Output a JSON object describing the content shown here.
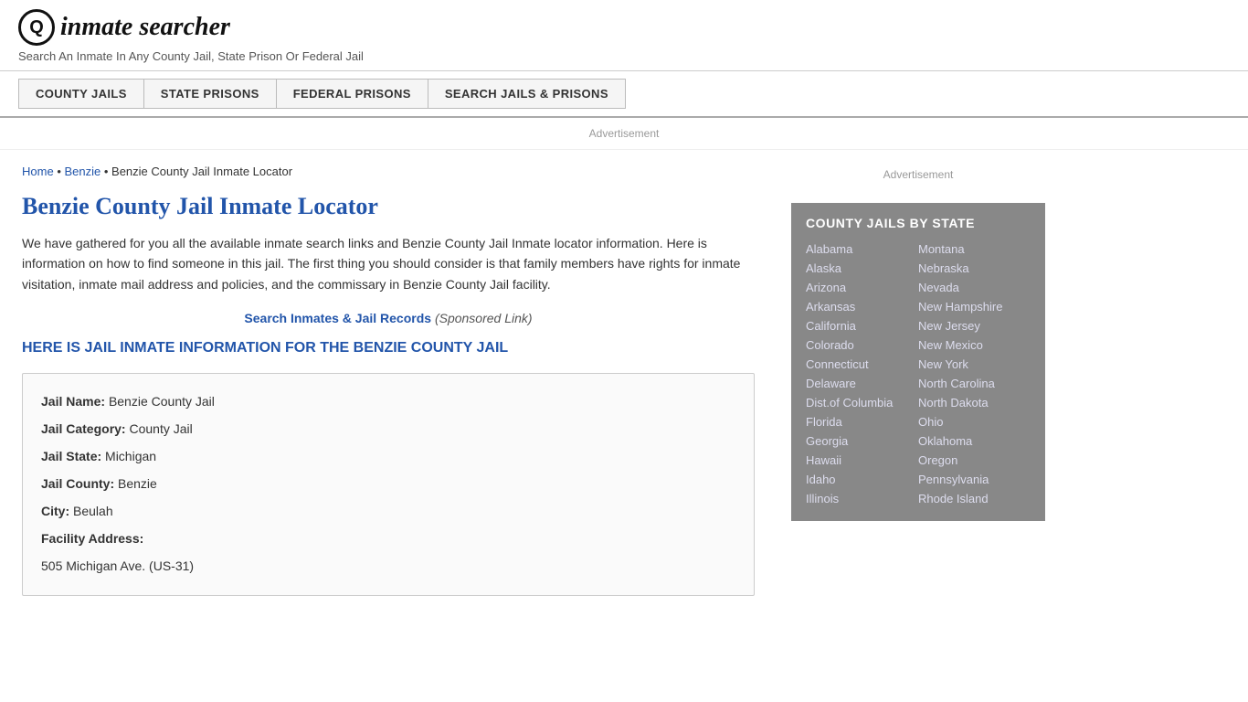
{
  "header": {
    "logo_icon": "🔍",
    "logo_text_prefix": "inmate",
    "logo_text_suffix": "searcher",
    "tagline": "Search An Inmate In Any County Jail, State Prison Or Federal Jail"
  },
  "nav": {
    "items": [
      {
        "label": "COUNTY JAILS"
      },
      {
        "label": "STATE PRISONS"
      },
      {
        "label": "FEDERAL PRISONS"
      },
      {
        "label": "SEARCH JAILS & PRISONS"
      }
    ]
  },
  "ad": {
    "top_label": "Advertisement",
    "sidebar_label": "Advertisement"
  },
  "breadcrumb": {
    "home": "Home",
    "parent": "Benzie",
    "current": "Benzie County Jail Inmate Locator"
  },
  "page": {
    "title": "Benzie County Jail Inmate Locator",
    "body": "We have gathered for you all the available inmate search links and Benzie County Jail Inmate locator information. Here is information on how to find someone in this jail. The first thing you should consider is that family members have rights for inmate visitation, inmate mail address and policies, and the commissary in Benzie County Jail facility.",
    "sponsored_link_text": "Search Inmates & Jail Records",
    "sponsored_label": "(Sponsored Link)",
    "section_heading": "HERE IS JAIL INMATE INFORMATION FOR THE BENZIE COUNTY JAIL"
  },
  "info": {
    "jail_name_label": "Jail Name:",
    "jail_name_value": "Benzie County Jail",
    "jail_category_label": "Jail Category:",
    "jail_category_value": "County Jail",
    "jail_state_label": "Jail State:",
    "jail_state_value": "Michigan",
    "jail_county_label": "Jail County:",
    "jail_county_value": "Benzie",
    "city_label": "City:",
    "city_value": "Beulah",
    "facility_address_label": "Facility Address:",
    "facility_address_value": "505 Michigan Ave. (US-31)"
  },
  "sidebar": {
    "title": "COUNTY JAILS BY STATE",
    "states_col1": [
      "Alabama",
      "Alaska",
      "Arizona",
      "Arkansas",
      "California",
      "Colorado",
      "Connecticut",
      "Delaware",
      "Dist.of Columbia",
      "Florida",
      "Georgia",
      "Hawaii",
      "Idaho",
      "Illinois"
    ],
    "states_col2": [
      "Montana",
      "Nebraska",
      "Nevada",
      "New Hampshire",
      "New Jersey",
      "New Mexico",
      "New York",
      "North Carolina",
      "North Dakota",
      "Ohio",
      "Oklahoma",
      "Oregon",
      "Pennsylvania",
      "Rhode Island"
    ]
  }
}
